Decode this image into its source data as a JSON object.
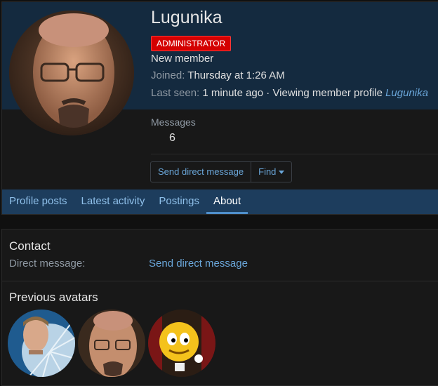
{
  "profile": {
    "username": "Lugunika",
    "role_badge": "ADMINISTRATOR",
    "user_title": "New member",
    "joined_label": "Joined:",
    "joined_value": "Thursday at 1:26 AM",
    "last_seen_label": "Last seen:",
    "last_seen_value": "1 minute ago · Viewing member profile",
    "last_seen_link": "Lugunika",
    "stats": {
      "messages_label": "Messages",
      "messages_value": "6"
    },
    "buttons": {
      "send_dm": "Send direct message",
      "find": "Find"
    }
  },
  "tabs": [
    {
      "label": "Profile posts",
      "active": false
    },
    {
      "label": "Latest activity",
      "active": false
    },
    {
      "label": "Postings",
      "active": false
    },
    {
      "label": "About",
      "active": true
    }
  ],
  "about": {
    "contact_heading": "Contact",
    "direct_message_label": "Direct message:",
    "direct_message_link": "Send direct message",
    "previous_avatars_heading": "Previous avatars"
  },
  "colors": {
    "badge_red": "#d40000",
    "header_blue": "#142a3f",
    "tab_bar": "#1d3d5d",
    "link": "#6aa6d9"
  }
}
